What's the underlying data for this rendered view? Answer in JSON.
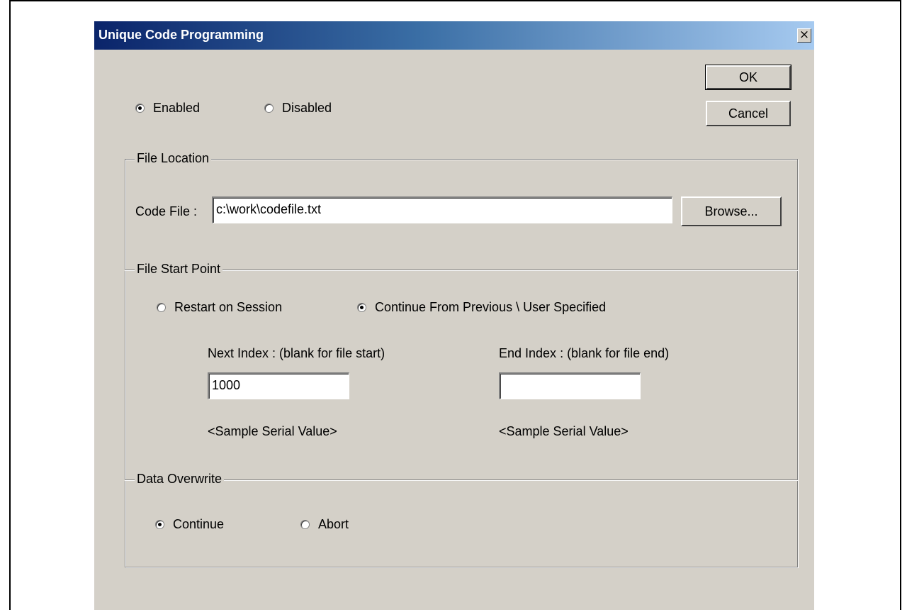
{
  "window": {
    "title": "Unique Code Programming",
    "close_glyph": "×"
  },
  "buttons": {
    "ok": "OK",
    "cancel": "Cancel",
    "browse": "Browse..."
  },
  "mode": {
    "options": [
      {
        "label": "Enabled",
        "checked": true
      },
      {
        "label": "Disabled",
        "checked": false
      }
    ]
  },
  "file_location": {
    "group_label": "File Location",
    "code_file_label": "Code File :",
    "code_file_value": "c:\\work\\codefile.txt"
  },
  "file_start_point": {
    "group_label": "File Start Point",
    "options": [
      {
        "label": "Restart on Session",
        "checked": false
      },
      {
        "label": "Continue From Previous \\ User Specified",
        "checked": true
      }
    ],
    "next_index_label": "Next Index : (blank for file start)",
    "next_index_value": "1000",
    "end_index_label": "End Index : (blank for file end)",
    "end_index_value": "",
    "next_sample": "<Sample Serial Value>",
    "end_sample": "<Sample Serial Value>"
  },
  "data_overwrite": {
    "group_label": "Data Overwrite",
    "options": [
      {
        "label": "Continue",
        "checked": true
      },
      {
        "label": "Abort",
        "checked": false
      }
    ]
  },
  "icons": {
    "close": "close-icon",
    "radio": "radio-button-icon"
  }
}
